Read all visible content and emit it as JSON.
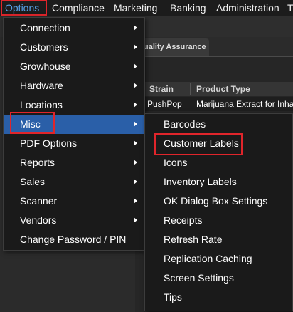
{
  "menubar": {
    "items": [
      "Options",
      "Compliance",
      "Marketing",
      "Banking",
      "Administration",
      "T"
    ]
  },
  "background": {
    "tab_label": "uality Assurance",
    "table": {
      "headers": [
        "Strain",
        "Product Type"
      ],
      "rows": [
        [
          "PushPop",
          "Marijuana Extract for Inhal"
        ]
      ]
    }
  },
  "options_menu": {
    "items": [
      "Connection",
      "Customers",
      "Growhouse",
      "Hardware",
      "Locations",
      "Misc",
      "PDF Options",
      "Reports",
      "Sales",
      "Scanner",
      "Vendors",
      "Change Password / PIN"
    ],
    "selected": "Misc"
  },
  "misc_submenu": {
    "items": [
      "Barcodes",
      "Customer Labels",
      "Icons",
      "Inventory Labels",
      "OK Dialog Box Settings",
      "Receipts",
      "Refresh Rate",
      "Replication Caching",
      "Screen Settings",
      "Tips"
    ],
    "highlighted": "Customer Labels"
  },
  "colors": {
    "highlight_box": "#e0252b",
    "selected_item": "#2a5fa8",
    "active_menu_text": "#56a0e6"
  }
}
